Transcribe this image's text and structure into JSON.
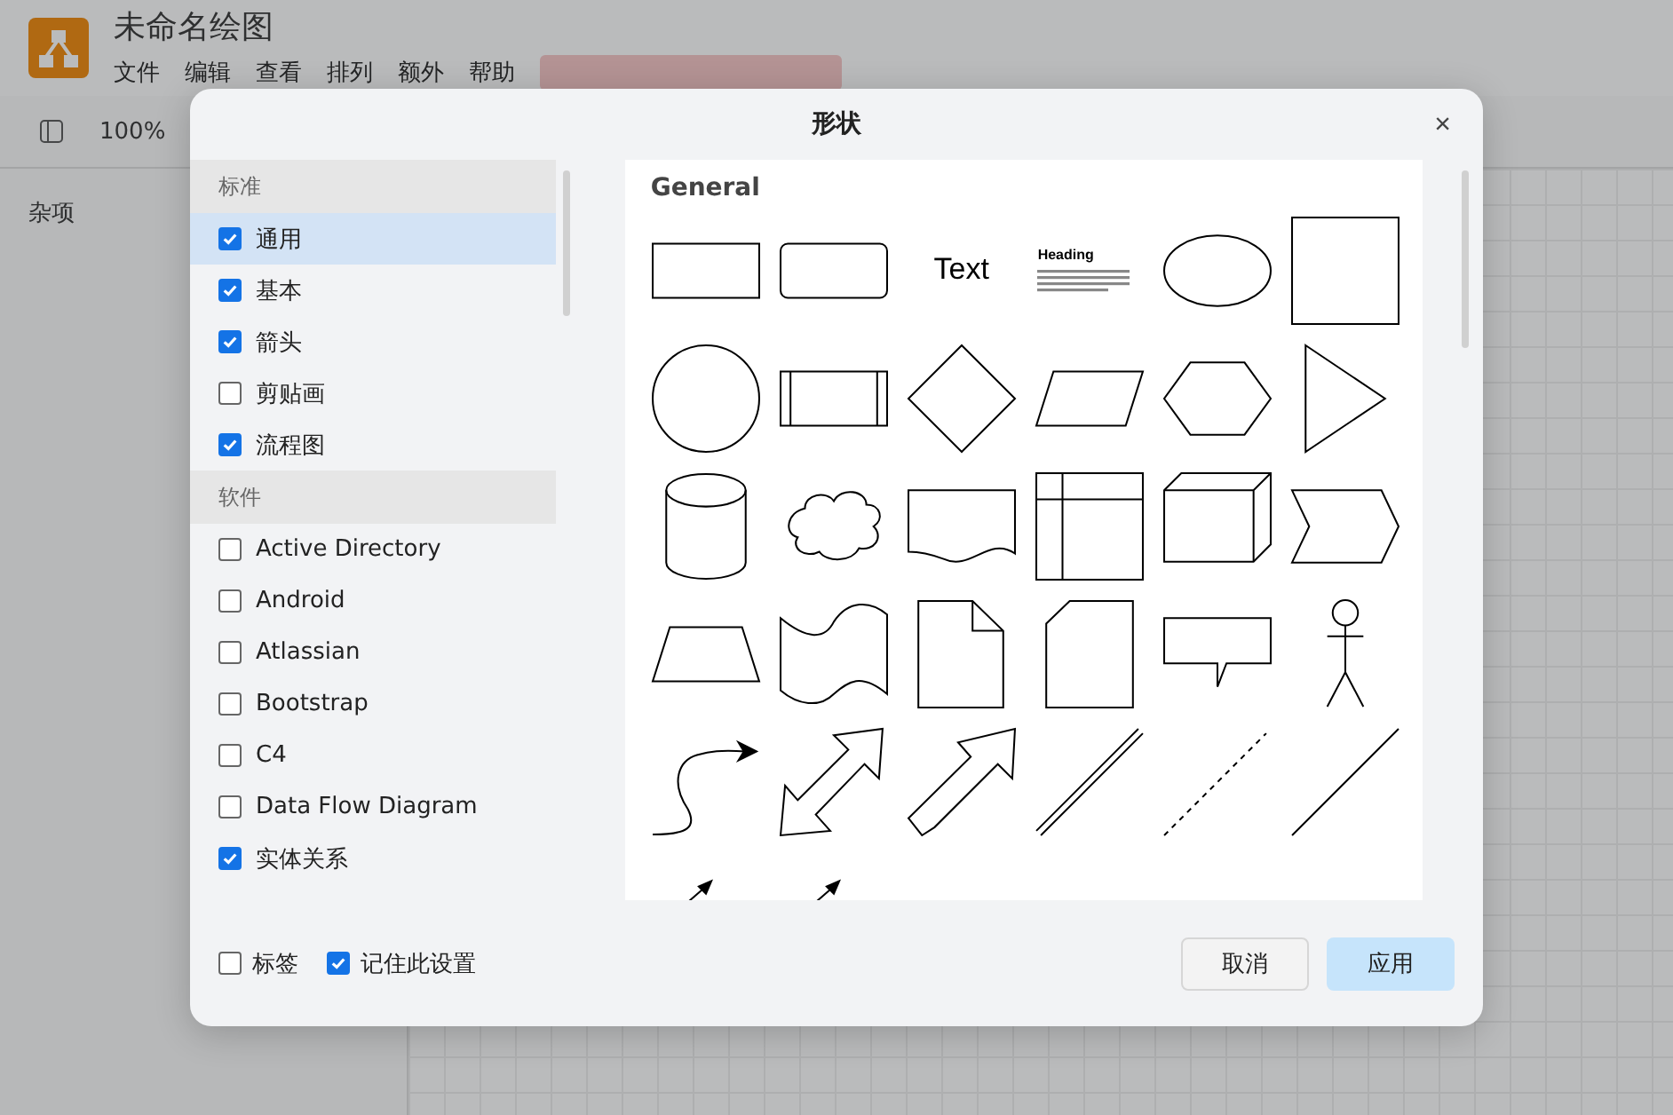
{
  "app": {
    "title": "未命名绘图",
    "menus": [
      "文件",
      "编辑",
      "查看",
      "排列",
      "额外",
      "帮助"
    ],
    "zoom": "100%",
    "sidebar_section": "杂项"
  },
  "dialog": {
    "title": "形状",
    "close": "×",
    "groups": [
      {
        "heading": "标准",
        "items": [
          {
            "label": "通用",
            "checked": true,
            "selected": true
          },
          {
            "label": "基本",
            "checked": true,
            "selected": false
          },
          {
            "label": "箭头",
            "checked": true,
            "selected": false
          },
          {
            "label": "剪贴画",
            "checked": false,
            "selected": false
          },
          {
            "label": "流程图",
            "checked": true,
            "selected": false
          }
        ]
      },
      {
        "heading": "软件",
        "items": [
          {
            "label": "Active Directory",
            "checked": false,
            "selected": false
          },
          {
            "label": "Android",
            "checked": false,
            "selected": false
          },
          {
            "label": "Atlassian",
            "checked": false,
            "selected": false
          },
          {
            "label": "Bootstrap",
            "checked": false,
            "selected": false
          },
          {
            "label": "C4",
            "checked": false,
            "selected": false
          },
          {
            "label": "Data Flow Diagram",
            "checked": false,
            "selected": false
          },
          {
            "label": "实体关系",
            "checked": true,
            "selected": false
          }
        ]
      }
    ],
    "preview_title": "General",
    "shapes": [
      {
        "kind": "rectangle"
      },
      {
        "kind": "rounded"
      },
      {
        "kind": "text",
        "label": "Text"
      },
      {
        "kind": "heading",
        "label": "Heading"
      },
      {
        "kind": "ellipse"
      },
      {
        "kind": "square"
      },
      {
        "kind": "circle"
      },
      {
        "kind": "process"
      },
      {
        "kind": "diamond"
      },
      {
        "kind": "parallelogram"
      },
      {
        "kind": "hexagon"
      },
      {
        "kind": "triangle"
      },
      {
        "kind": "cylinder"
      },
      {
        "kind": "cloud"
      },
      {
        "kind": "document"
      },
      {
        "kind": "storage"
      },
      {
        "kind": "cube"
      },
      {
        "kind": "step"
      },
      {
        "kind": "trapezoid"
      },
      {
        "kind": "tape"
      },
      {
        "kind": "note"
      },
      {
        "kind": "card"
      },
      {
        "kind": "callout"
      },
      {
        "kind": "actor"
      },
      {
        "kind": "curve"
      },
      {
        "kind": "bidirectional"
      },
      {
        "kind": "arrow"
      },
      {
        "kind": "link"
      },
      {
        "kind": "dashed"
      },
      {
        "kind": "line"
      },
      {
        "kind": "small_arrow"
      },
      {
        "kind": "small_arrow"
      }
    ],
    "footer_options": [
      {
        "label": "标签",
        "checked": false
      },
      {
        "label": "记住此设置",
        "checked": true
      }
    ],
    "cancel": "取消",
    "apply": "应用"
  }
}
